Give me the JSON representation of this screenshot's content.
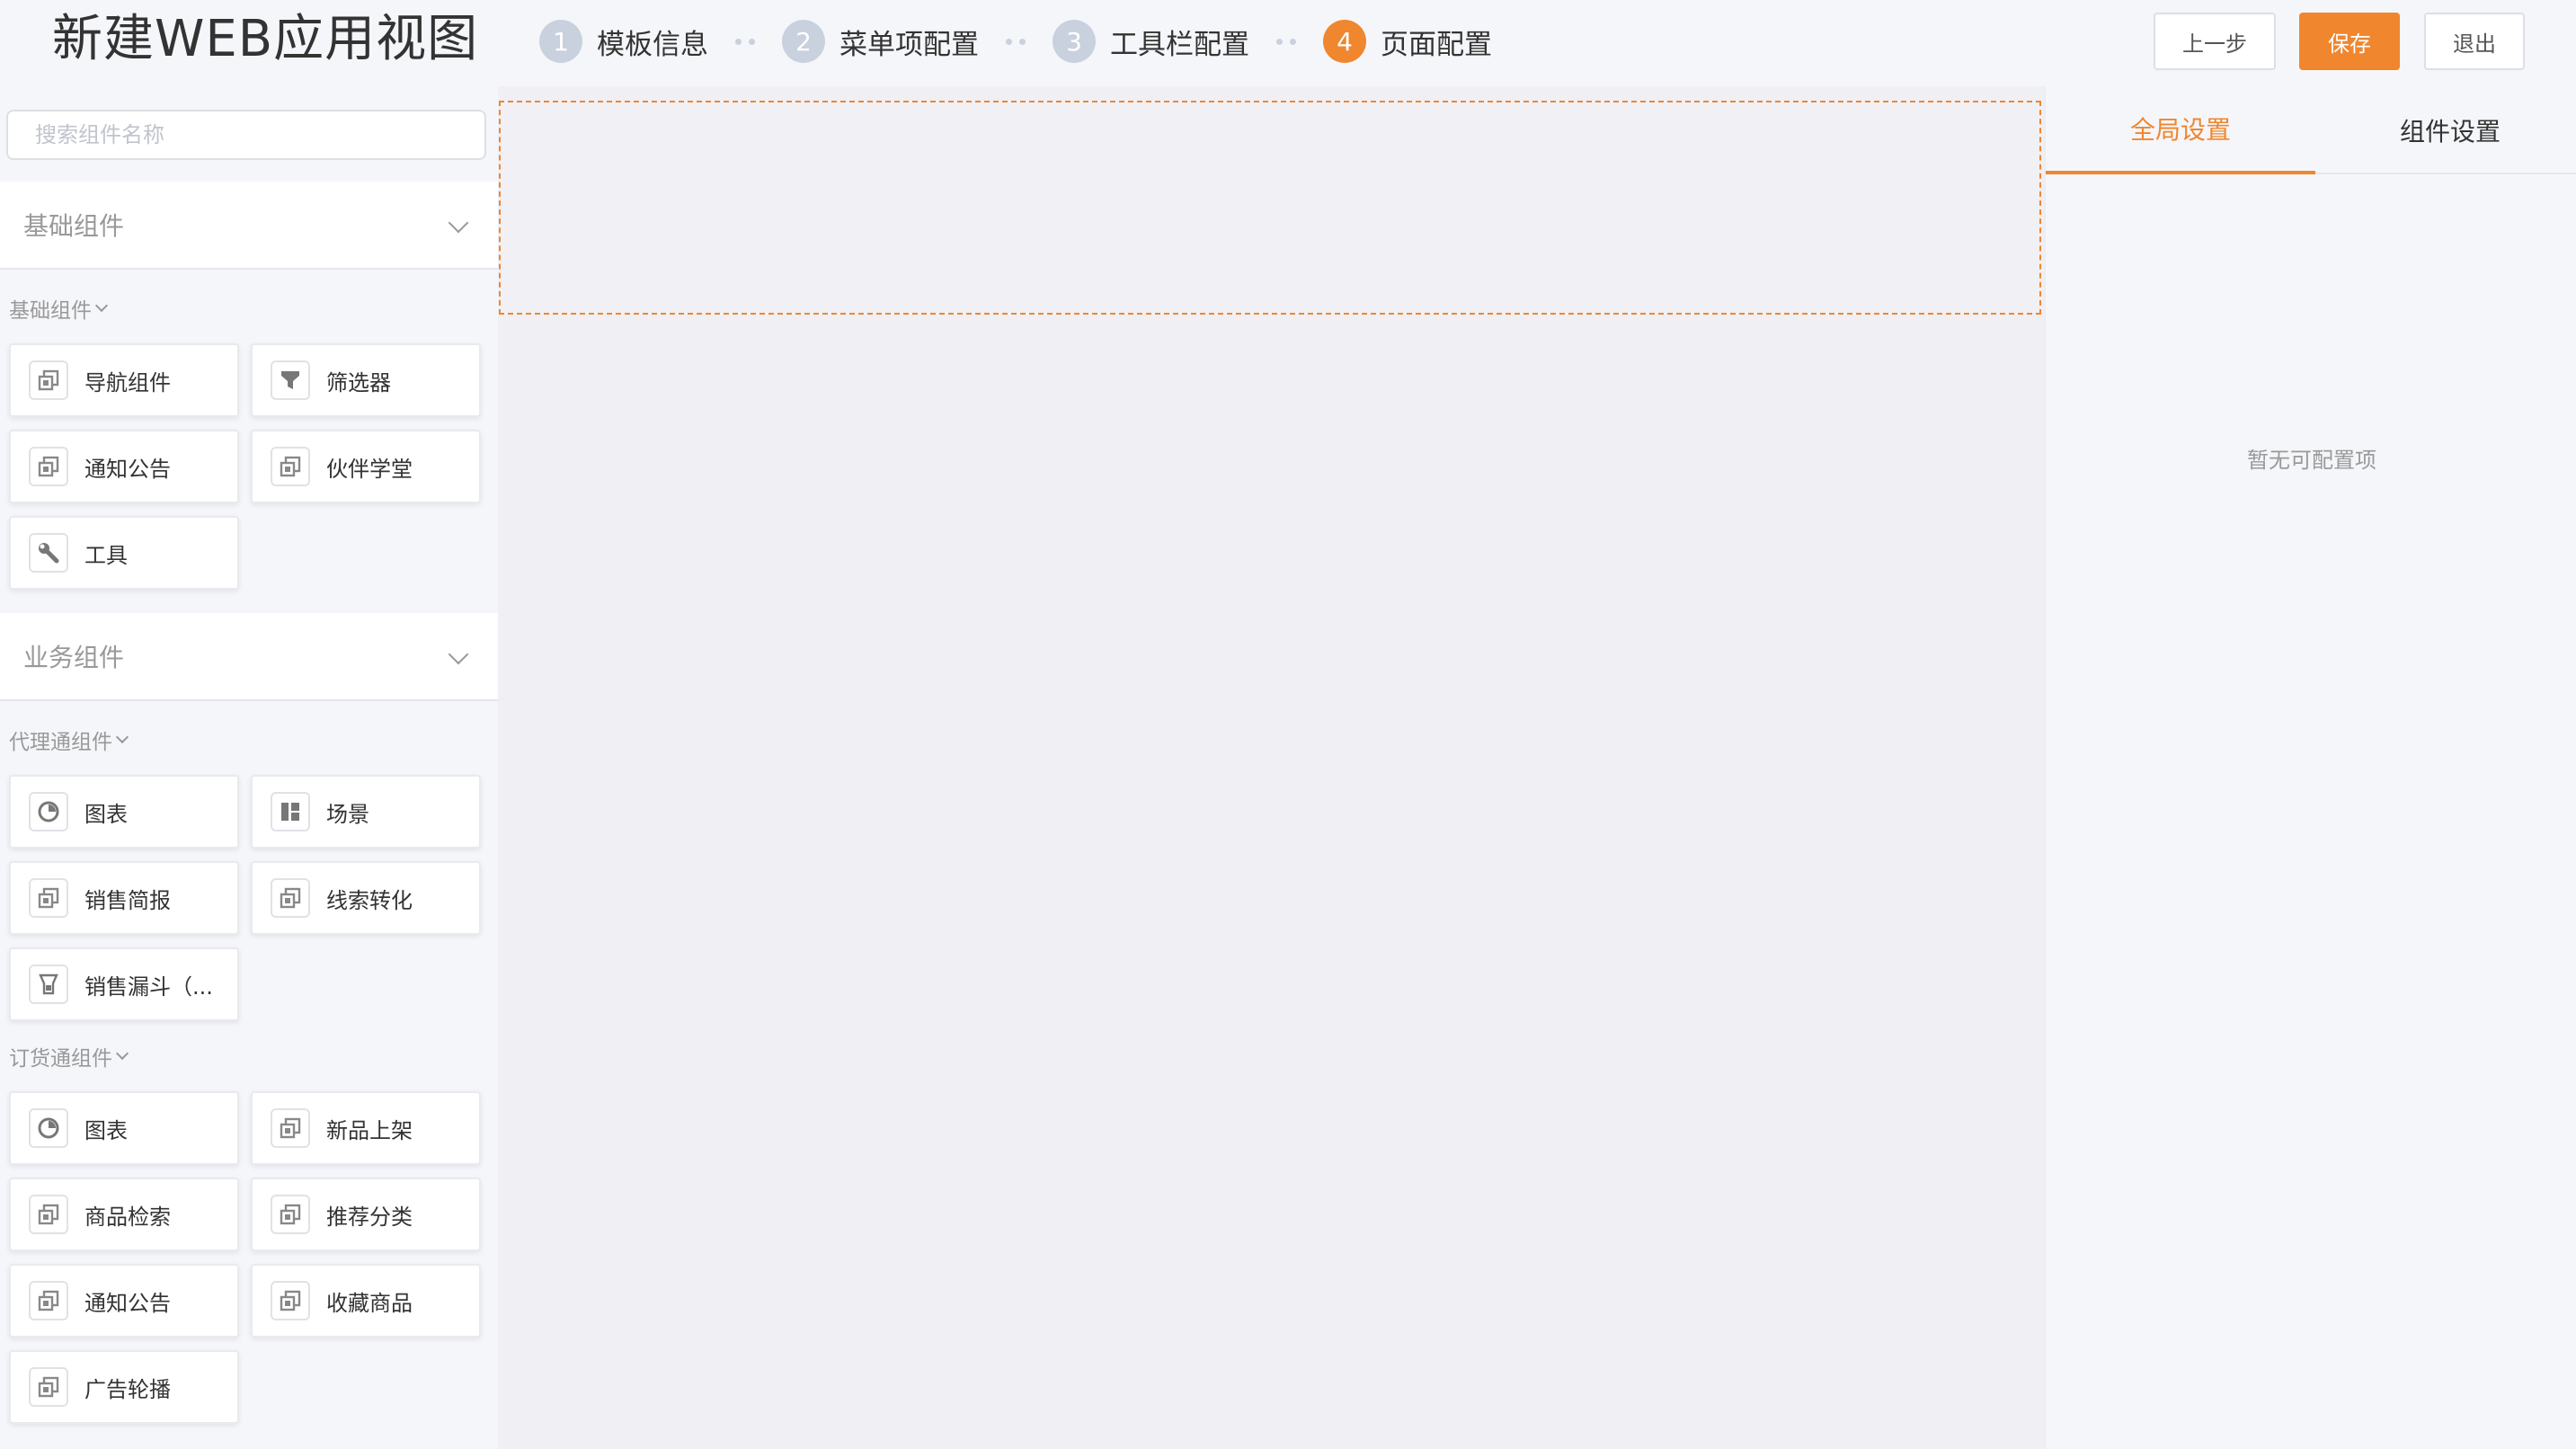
{
  "header": {
    "title": "新建WEB应用视图",
    "steps": [
      {
        "num": "1",
        "label": "模板信息"
      },
      {
        "num": "2",
        "label": "菜单项配置"
      },
      {
        "num": "3",
        "label": "工具栏配置"
      },
      {
        "num": "4",
        "label": "页面配置"
      }
    ],
    "active_step": 4,
    "buttons": {
      "prev": "上一步",
      "save": "保存",
      "exit": "退出"
    },
    "accent_color": "#f0862e"
  },
  "sidebar": {
    "search_placeholder": "搜索组件名称",
    "categories": [
      {
        "title": "基础组件",
        "groups": [
          {
            "label": "基础组件",
            "items": [
              {
                "label": "导航组件",
                "icon": "component-icon"
              },
              {
                "label": "筛选器",
                "icon": "filter-icon"
              },
              {
                "label": "通知公告",
                "icon": "component-icon"
              },
              {
                "label": "伙伴学堂",
                "icon": "component-icon"
              },
              {
                "label": "工具",
                "icon": "wrench-icon"
              }
            ]
          }
        ]
      },
      {
        "title": "业务组件",
        "groups": [
          {
            "label": "代理通组件",
            "items": [
              {
                "label": "图表",
                "icon": "pie-chart-icon"
              },
              {
                "label": "场景",
                "icon": "layout-icon"
              },
              {
                "label": "销售简报",
                "icon": "component-icon"
              },
              {
                "label": "线索转化",
                "icon": "component-icon"
              },
              {
                "label": "销售漏斗（...",
                "icon": "funnel-icon"
              }
            ]
          },
          {
            "label": "订货通组件",
            "items": [
              {
                "label": "图表",
                "icon": "pie-chart-icon"
              },
              {
                "label": "新品上架",
                "icon": "component-icon"
              },
              {
                "label": "商品检索",
                "icon": "component-icon"
              },
              {
                "label": "推荐分类",
                "icon": "component-icon"
              },
              {
                "label": "通知公告",
                "icon": "component-icon"
              },
              {
                "label": "收藏商品",
                "icon": "component-icon"
              },
              {
                "label": "广告轮播",
                "icon": "component-icon"
              }
            ]
          }
        ]
      }
    ]
  },
  "right_panel": {
    "tabs": [
      {
        "label": "全局设置",
        "active": true
      },
      {
        "label": "组件设置",
        "active": false
      }
    ],
    "empty_text": "暂无可配置项"
  }
}
